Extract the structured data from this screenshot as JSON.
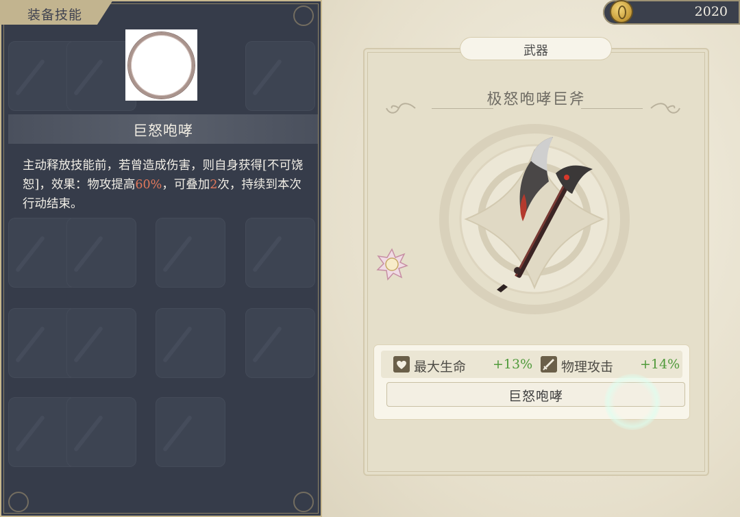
{
  "currency": {
    "amount": "2020",
    "icon": "gold-coin-icon"
  },
  "equip_panel": {
    "tab_title": "装备技能",
    "skill_name": "巨怒咆哮",
    "description": {
      "p1": "主动释放技能前，若曾造成伤害，则自身获得[不可饶恕]，效果：物攻提高",
      "pct": "60%",
      "p2": "，可叠加",
      "stacks": "2",
      "p3": "次，持续到本次行动结束。"
    }
  },
  "weapon_card": {
    "category": "武器",
    "name": "极怒咆哮巨斧",
    "stats": [
      {
        "label": "最大生命",
        "value": "+13%",
        "icon": "heart-icon"
      },
      {
        "label": "物理攻击",
        "value": "+14%",
        "icon": "sword-icon"
      }
    ],
    "skill": "巨怒咆哮"
  },
  "colors": {
    "panel_dark": "#363c4a",
    "highlight_orange": "#e2795c",
    "stat_green": "#4f9a3a",
    "parchment": "#e5dfca"
  }
}
